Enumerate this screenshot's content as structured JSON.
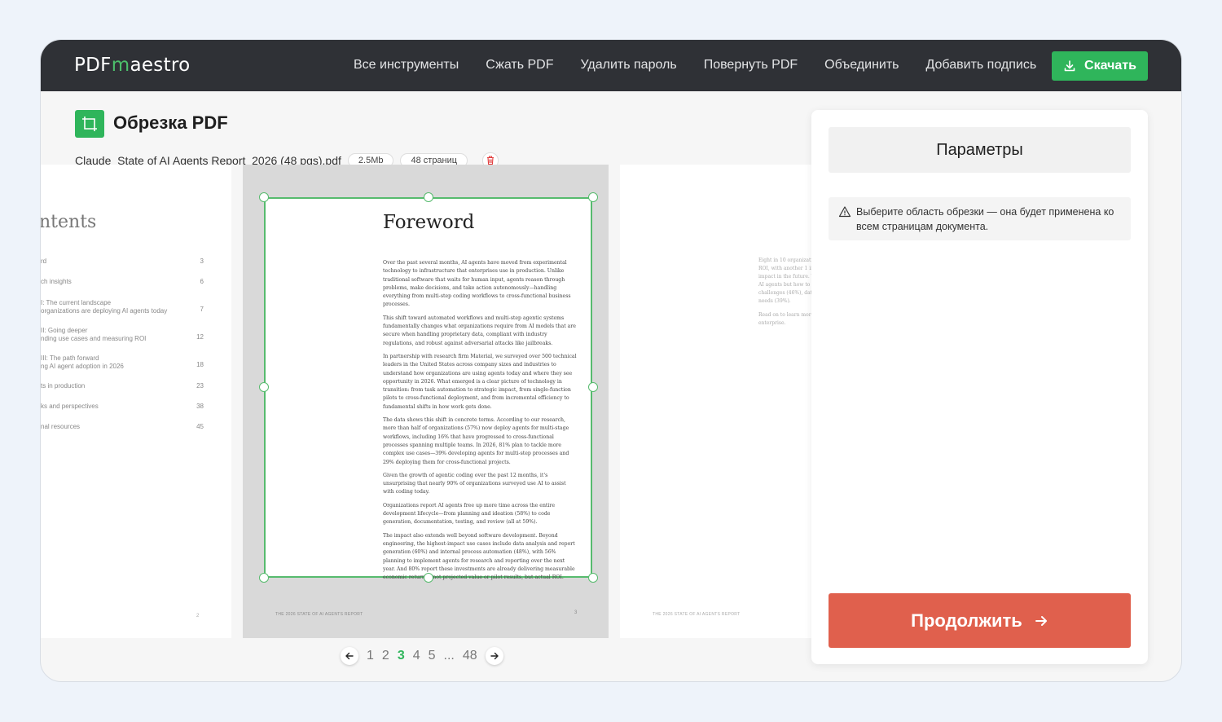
{
  "app": {
    "logo_prefix": "PDF",
    "logo_m": "m",
    "logo_suffix": "aestro"
  },
  "nav": {
    "items": [
      "Все инструменты",
      "Сжать PDF",
      "Удалить пароль",
      "Повернуть PDF",
      "Объединить",
      "Добавить подпись"
    ],
    "download_label": "Скачать",
    "download_icon": "download-icon"
  },
  "tool": {
    "title": "Обрезка PDF",
    "icon": "crop-icon"
  },
  "file": {
    "name": "Claude_State of AI Agents Report_2026 (48 pgs).pdf",
    "size": "2.5Mb",
    "pages": "48 страниц"
  },
  "pages": {
    "left": {
      "title": "ntents",
      "rows": [
        {
          "label": "rd",
          "page": "3"
        },
        {
          "label": "ch insights",
          "page": "6"
        },
        {
          "label": "I: The current landscape",
          "sub": "organizations are deploying AI agents today",
          "page": "7"
        },
        {
          "label": "II: Going deeper",
          "sub": "nding use cases and measuring ROI",
          "page": "12"
        },
        {
          "label": "III: The path forward",
          "sub": "ng AI agent adoption in 2026",
          "page": "18"
        },
        {
          "label": "ts in production",
          "page": "23"
        },
        {
          "label": "ks and perspectives",
          "page": "38"
        },
        {
          "label": "nal resources",
          "page": "45"
        }
      ],
      "footer_page": "2"
    },
    "current": {
      "heading": "Foreword",
      "paragraphs": [
        "Over the past several months, AI agents have moved from experimental technology to infrastructure that enterprises use in production. Unlike traditional software that waits for human input, agents reason through problems, make decisions, and take action autonomously—handling everything from multi-step coding workflows to cross-functional business processes.",
        "This shift toward automated workflows and multi-step agentic systems fundamentally changes what organizations require from AI models that are secure when handling proprietary data, compliant with industry regulations, and robust against adversarial attacks like jailbreaks.",
        "In partnership with research firm Material, we surveyed over 500 technical leaders in the United States across company sizes and industries to understand how organizations are using agents today and where they see opportunity in 2026. What emerged is a clear picture of technology in transition: from task automation to strategic impact, from single-function pilots to cross-functional deployment, and from incremental efficiency to fundamental shifts in how work gets done.",
        "The data shows this shift in concrete terms. According to our research, more than half of organizations (57%) now deploy agents for multi-stage workflows, including 16% that have progressed to cross-functional processes spanning multiple teams. In 2026, 81% plan to tackle more complex use cases—39% developing agents for multi-step processes and 29% deploying them for cross-functional projects.",
        "Given the growth of agentic coding over the past 12 months, it's unsurprising that nearly 90% of organizations surveyed use AI to assist with coding today.",
        "Organizations report AI agents free up more time across the entire development lifecycle—from planning and ideation (58%) to code generation, documentation, testing, and review (all at 59%).",
        "The impact also extends well beyond software development. Beyond engineering, the highest-impact use cases include data analysis and report generation (60%) and internal process automation (48%), with 56% planning to implement agents for research and reporting over the next year. And 80% report these investments are already delivering measurable economic returns—not projected value or pilot results, but actual ROI."
      ],
      "footer_title": "THE 2026 STATE OF AI AGENTS REPORT",
      "footer_page": "3"
    },
    "right": {
      "lines": [
        "Eight in 10 organizati",
        "ROI, with another 1 in",
        "impact in the future. T",
        "AI agents but how to",
        "challenges (46%), dat",
        "needs (39%).",
        "",
        "Read on to learn more",
        "enterprise."
      ],
      "footer_title": "THE 2026 STATE OF AI AGENTS REPORT"
    }
  },
  "pager": {
    "pages": [
      "1",
      "2",
      "3",
      "4",
      "5",
      "...",
      "48"
    ],
    "active": "3"
  },
  "panel": {
    "title": "Параметры",
    "hint": "Выберите область обрезки — она будет применена ко всем страницам документа.",
    "continue_label": "Продолжить"
  },
  "colors": {
    "accent": "#2fb55b",
    "continue": "#e0604d",
    "topbar": "#2f3136"
  }
}
